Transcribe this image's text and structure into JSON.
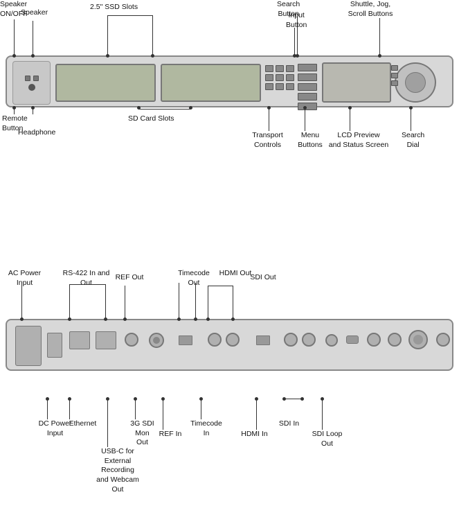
{
  "top": {
    "labels": {
      "speaker_onoff": "Speaker\nON/OFF",
      "speaker": "Speaker",
      "ssd_slots": "2.5\" SSD Slots",
      "search_button": "Search\nButton",
      "input_button": "Input\nButton",
      "shuttle_jog": "Shuttle, Jog,\nScroll Buttons",
      "remote_button": "Remote\nButton",
      "headphone": "Headphone",
      "sd_card_slots": "SD Card Slots",
      "transport_controls": "Transport\nControls",
      "menu_buttons": "Menu\nButtons",
      "lcd_preview": "LCD Preview\nand Status Screen",
      "search_dial": "Search\nDial"
    }
  },
  "bottom": {
    "labels": {
      "ac_power": "AC Power\nInput",
      "rs422": "RS-422 In and Out",
      "ref_out": "REF Out",
      "timecode_out": "Timecode\nOut",
      "hdmi_out": "HDMI Out",
      "sdi_out": "SDI Out",
      "dc_power": "DC Power\nInput",
      "ethernet": "Ethernet",
      "usb_c": "USB-C for\nExternal Recording\nand Webcam Out",
      "three_g_sdi": "3G SDI\nMon\nOut",
      "ref_in": "REF In",
      "timecode_in": "Timecode\nIn",
      "hdmi_in": "HDMI In",
      "sdi_in": "SDI In",
      "sdi_loop": "SDI Loop\nOut"
    }
  }
}
